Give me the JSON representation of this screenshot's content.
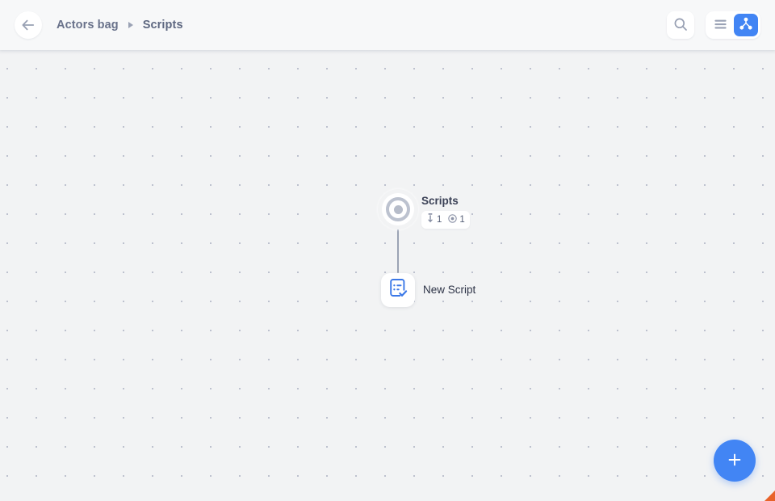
{
  "header": {
    "back_button": {
      "name": "back",
      "icon": "arrow-left-icon"
    },
    "breadcrumb": {
      "items": [
        {
          "label": "Actors bag"
        },
        {
          "label": "Scripts"
        }
      ],
      "separator": "▶"
    },
    "search": {
      "label": "Search",
      "icon": "search-icon"
    },
    "view_toggle": {
      "options": [
        {
          "id": "list",
          "label": "List view",
          "icon": "list-icon",
          "active": false
        },
        {
          "id": "graph",
          "label": "Graph view",
          "icon": "hierarchy-icon",
          "active": true
        }
      ],
      "active_color": "#4285f4"
    }
  },
  "graph": {
    "root": {
      "title": "Scripts",
      "icon": "target-node-icon",
      "badges": [
        {
          "icon": "depth-icon",
          "value": "1"
        },
        {
          "icon": "node-count-icon",
          "value": "1"
        }
      ]
    },
    "children": [
      {
        "label": "New Script",
        "icon": "script-check-icon",
        "icon_color": "#3b78e7"
      }
    ]
  },
  "fab": {
    "label": "Add",
    "icon": "plus-icon",
    "color": "#4285f4"
  },
  "canvas": {
    "background": "#f2f3f4",
    "dot_color": "#b9bdcb",
    "grid_spacing": 36
  }
}
